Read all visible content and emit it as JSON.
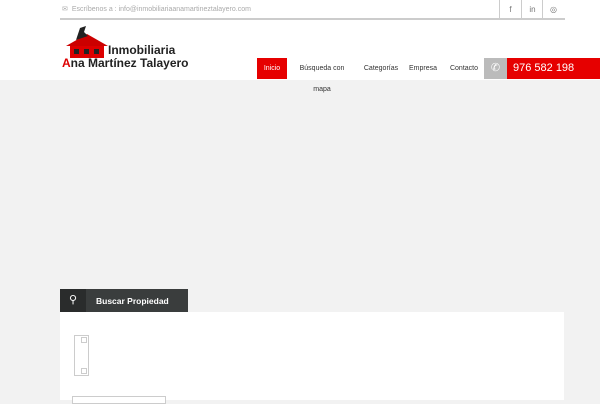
{
  "topbar": {
    "email": "Escríbenos a : info@inmobiliariaanamartineztalayero.com",
    "social": [
      "facebook-icon",
      "linkedin-icon",
      "instagram-icon"
    ]
  },
  "logo": {
    "line1": "Inmobiliaria",
    "line2_initial": "A",
    "line2_rest": "na Martínez Talayero"
  },
  "nav": {
    "items": [
      "Inicio",
      "Búsqueda con mapa",
      "Categorías",
      "Empresa",
      "Contacto"
    ],
    "phone": "976 582 198"
  },
  "search": {
    "title": "Buscar Propiedad"
  },
  "colors": {
    "accent": "#e60000",
    "dark": "#3a3d3d"
  }
}
